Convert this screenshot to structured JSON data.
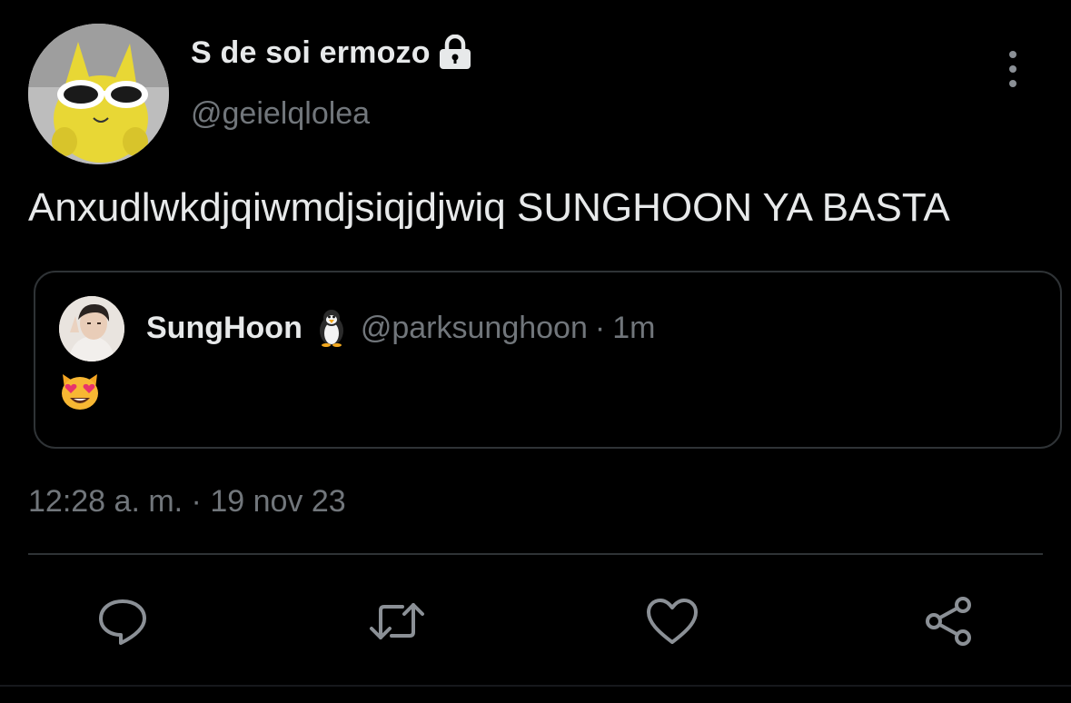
{
  "tweet": {
    "author": {
      "display_name": "S de soi ermozo",
      "handle": "@geielqlolea",
      "locked_icon": "lock-icon"
    },
    "text": "Anxudlwkdjqiwmdjsiqjdjwiq SUNGHOON YA BASTA",
    "timestamp": "12:28 a. m. · 19 nov 23"
  },
  "quoted_tweet": {
    "display_name": "SungHoon",
    "name_emoji": "penguin-emoji",
    "handle": "@parksunghoon",
    "separator": "·",
    "time": "1m",
    "body_emoji": "smiling-cat-heart-eyes-emoji"
  },
  "actions": {
    "reply_icon": "reply-icon",
    "retweet_icon": "retweet-icon",
    "like_icon": "heart-icon",
    "share_icon": "share-icon"
  },
  "colors": {
    "background": "#000000",
    "primary_text": "#e7e9ea",
    "secondary_text": "#71767b",
    "border": "#2f3336"
  }
}
